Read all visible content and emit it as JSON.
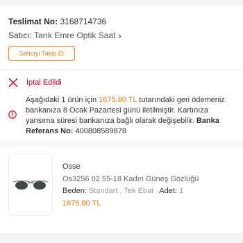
{
  "order": {
    "number_label": "Teslimat No:",
    "number_value": "3168714736",
    "seller_label": "Satıcı:",
    "seller_value": "Tarık Emre Optik Saat",
    "follow_button": "Satıcıyı Takip Et"
  },
  "status": {
    "label": "İptal Edildi",
    "color": "#d0021b"
  },
  "notice": {
    "part1": "Aşağıdaki 1 ürün için ",
    "amount": "1675.80 TL",
    "part2": " tutarındaki geri ödemeniz bankanıza 8 Ocak Pazartesi günü iletilmiştir. Kartınıza yansıma süresi bankanıza bağlı olarak değişebilir. ",
    "ref_label": "Banka Referans No:",
    "ref_value": " 400808589878"
  },
  "product": {
    "brand": "Osse",
    "name": "Os3256 02 55-18 Kadın Güneş Gözlüğü",
    "size_label": "Beden:",
    "size_value": " Standart , Tek Ebat",
    "qty_label": "Adet:",
    "qty_value": " 1",
    "price": "1675.80 TL",
    "image_icon": "sunglasses-icon"
  },
  "colors": {
    "accent": "#f27a1a",
    "cancel": "#d0021b"
  }
}
